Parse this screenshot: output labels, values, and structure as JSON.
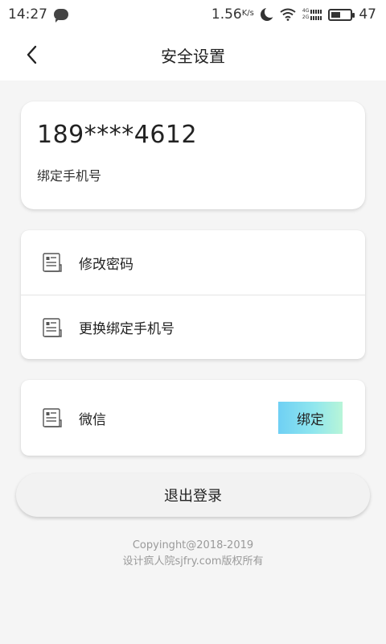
{
  "status_bar": {
    "time": "14:27",
    "network_speed": "1.56",
    "network_unit": "K/s",
    "signal_top": "4G",
    "signal_bottom": "2G",
    "battery_level": 47,
    "battery_text": "47",
    "icons": [
      "chat-bubble-icon",
      "moon-icon",
      "wifi-icon",
      "signal-icon",
      "battery-icon"
    ]
  },
  "nav": {
    "title": "安全设置",
    "back_icon": "chevron-left-icon"
  },
  "account": {
    "phone_number": "189****4612",
    "caption": "绑定手机号"
  },
  "menu": {
    "items": [
      {
        "label": "修改密码",
        "icon": "document-icon"
      },
      {
        "label": "更换绑定手机号",
        "icon": "document-icon"
      }
    ]
  },
  "wechat": {
    "label": "微信",
    "icon": "document-icon",
    "bind_label": "绑定",
    "bind_gradient": [
      "#6fd0f4",
      "#8fe6ee",
      "#b8f5d8"
    ]
  },
  "logout_label": "退出登录",
  "footer": {
    "line1": "Copyinght@2018-2019",
    "line2": "设计疯人院sjfry.com版权所有"
  }
}
